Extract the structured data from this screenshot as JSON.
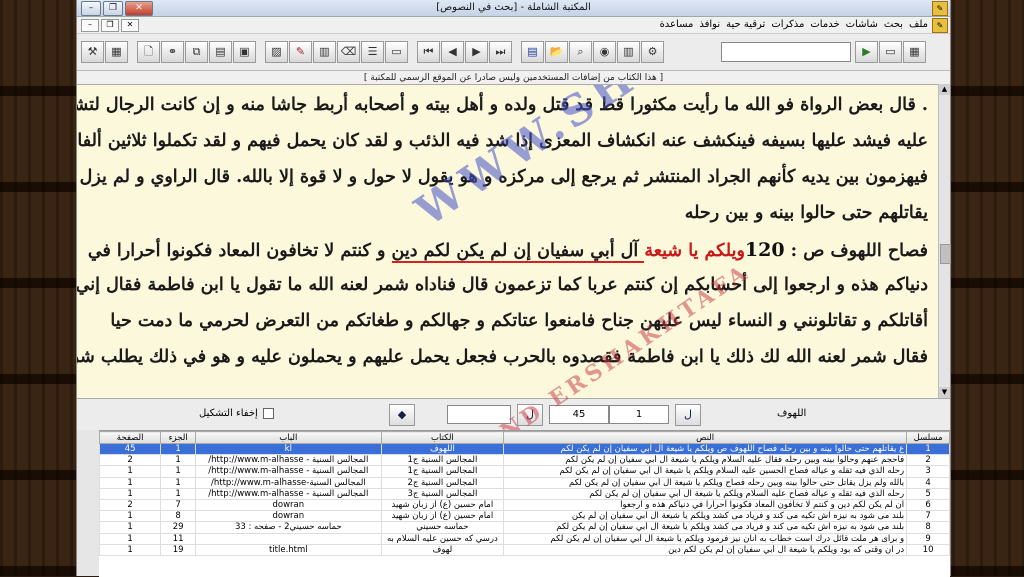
{
  "window": {
    "title": "المكتبة الشاملة - [بحث في النصوص]"
  },
  "menu": {
    "items": [
      "ملف",
      "بحث",
      "شاشات",
      "خدمات",
      "مذكرات",
      "ترقية حية",
      "نوافذ",
      "مساعدة"
    ]
  },
  "notice": "[ هذا الكتاب من إضافات المستخدمين وليس صادرا عن الموقع الرسمي للمكتبة ]",
  "text_lines": [
    ". قال بعض الرواة فو الله ما رأيت مكثورا قط قد قتل ولده و أهل بيته و أصحابه أربط جاشا منه و إن كانت الرجال لتشد",
    "عليه فيشد عليها بسيفه فينكشف عنه انكشاف المعزى إذا شد فيه الذئب و لقد كان يحمل فيهم و لقد تكملوا ثلاثين ألفا",
    "فيهزمون بين يديه كأنهم الجراد المنتشر ثم يرجع إلى مركزه و هو يقول لا حول و لا قوة إلا بالله. قال الراوي و لم يزل ع",
    "يقاتلهم حتى حالوا بينه و بين رحله"
  ],
  "highlight_line": {
    "prefix": "فصاح اللهوف ص : ",
    "number": "120",
    "red": "ويلكم يا شيعة",
    "underlined": " آل أبي سفيان إن لم يكن لكم دين",
    "rest": " و كنتم لا تخافون المعاد فكونوا أحرارا في"
  },
  "text_lines_after": [
    "دنياكم هذه و ارجعوا إلى أحسابكم إن كنتم عربا كما تزعمون قال فناداه شمر لعنه الله ما تقول يا ابن فاطمة فقال إني أقول",
    "أقاتلكم و تقاتلونني و النساء ليس عليهن جناح فامنعوا عتاتكم و جهالكم و طغاتكم من التعرض لحرمي ما دمت حيا",
    "فقال شمر لعنه الله لك ذلك يا ابن فاطمة فقصدوه بالحرب فجعل يحمل عليهم و يحملون عليه و هو في ذلك يطلب شربة"
  ],
  "watermark": "WWW.SHIAHAQ.COM",
  "watermark2": "FARAND ERSHAKHTAFA",
  "controls": {
    "book_label": "اللهوف",
    "page_from": "1",
    "page_to": "45",
    "hide_diacritics_label": "إخفاء التشكيل",
    "nav_prev": "ل",
    "nav_next": "ل"
  },
  "table": {
    "headers": [
      "مسلسل",
      "النص",
      "الكتاب",
      "الباب",
      "الجزء",
      "الصفحة"
    ],
    "rows": [
      [
        "1",
        "ع يقاتلهم حتى حالوا بينه و بين رحله فصاح اللهوف ص ويلكم يا شيعة آل أبي سفيان إن لم يكن لكم",
        "اللهوف",
        "kl",
        "1",
        "45"
      ],
      [
        "2",
        "فأحجم عنهم وحالوا بينه وبين رحله فقال عليه السلام ويلكم يا شيعة آل أبي سفيان إن لم يكن لكم",
        "المجالس السنية ج1",
        "المجالس السنية - http://www.m-alhasse/",
        "1",
        "2"
      ],
      [
        "3",
        "رحله الذي فيه ثقله و عياله فصاح الحسين عليه السلام ويلكم يا شيعة آل أبي سفيان إن لم يكن لكم",
        "المجالس السنية ج1",
        "المجالس السنية - http://www.m-alhasse/",
        "1",
        "1"
      ],
      [
        "4",
        "بالله ولم يزل يقاتل حتى حالوا بينه وبين رحله فصاح ويلكم يا شيعة آل أبي سفيان إن لم يكن لكم",
        "المجالس السنية ج2",
        "المجالس السنية-http://www.m-alhasse/",
        "1",
        "1"
      ],
      [
        "5",
        "رحله الذي فيه ثقله و عياله فصاح عليه السلام ويلكم يا شيعة آل أبي سفيان إن لم يكن لكم",
        "المجالس السنية ج3",
        "المجالس السنية - http://www.m-alhasse/",
        "1",
        "1"
      ],
      [
        "6",
        "ان لم يكن لكم دين و كنتم لا تخافون المعاد فكونوا أحرارا في دنياكم هذه و ارجعوا",
        "امام حسين (ع) از زبان شهيد",
        "dowran",
        "7",
        "2"
      ],
      [
        "7",
        "بلند مى شود به نيزه اش تكيه مى كند و فرياد مى كشد ويلكم يا شيعة آل أبي سفيان إن لم يكن",
        "امام حسين (ع) از زبان شهيد",
        "dowran",
        "8",
        "1"
      ],
      [
        "8",
        "بلند مى شود به نيزه اش تكيه مى كند و فرياد مى كشد ويلكم يا شيعة آل أبي سفيان إن لم يكن لكم",
        "حماسه حسيني",
        "حماسه حسيني2 - صفحه : 33",
        "29",
        "1"
      ],
      [
        "9",
        "و براى هر ملت قائل درك است خطاب به آنان نيز فرمود ويلكم يا شيعة آل أبي سفيان إن لم يكن لكم",
        "درسي كه حسين عليه السلام به",
        "",
        "11",
        "1"
      ],
      [
        "10",
        "در آن وقتى كه بود ويلكم يا شيعة آل أبي سفيان إن لم يكن لكم دين",
        "لهوف",
        "title.html",
        "19",
        "1"
      ]
    ]
  }
}
